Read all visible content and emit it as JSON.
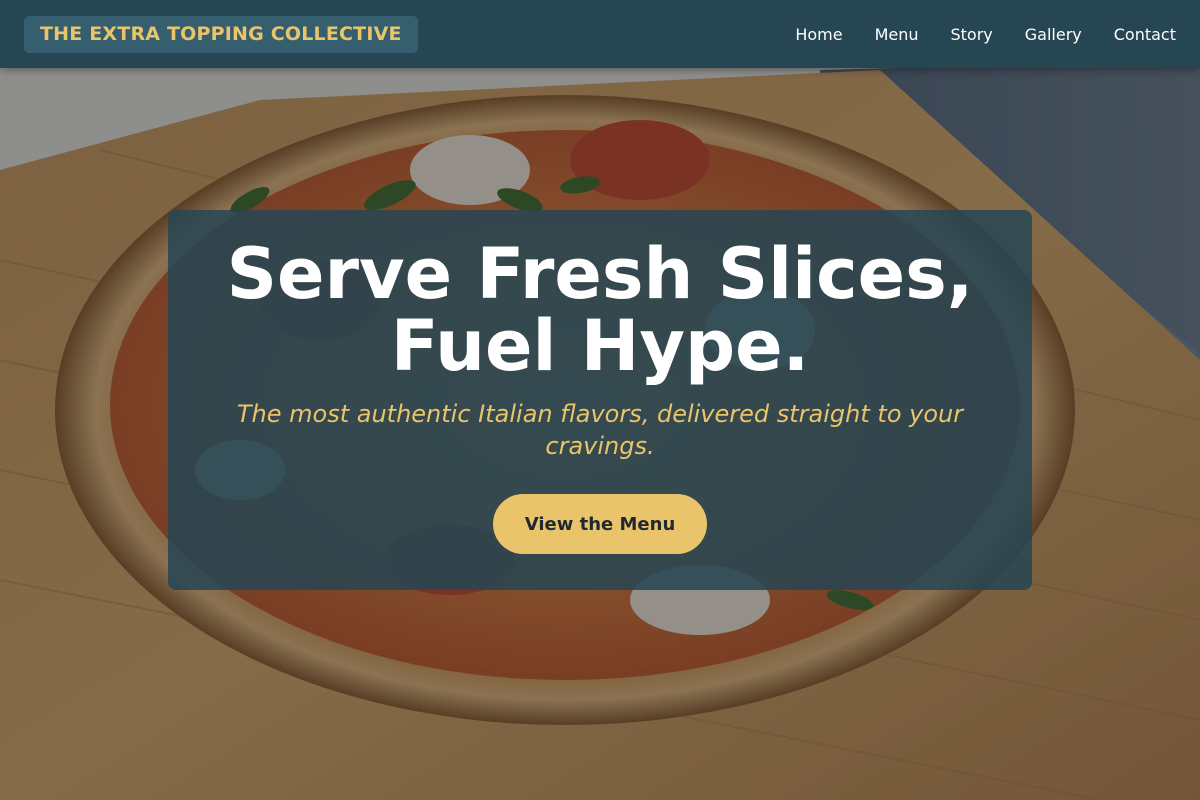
{
  "brand": {
    "name": "THE EXTRA TOPPING COLLECTIVE"
  },
  "nav": {
    "items": [
      {
        "label": "Home"
      },
      {
        "label": "Menu"
      },
      {
        "label": "Story"
      },
      {
        "label": "Gallery"
      },
      {
        "label": "Contact"
      }
    ]
  },
  "hero": {
    "title_line1": "Serve Fresh Slices,",
    "title_line2": "Fuel Hype.",
    "subtitle": "The most authentic Italian flavors, delivered straight to your cravings.",
    "cta_label": "View the Menu",
    "background": "pizza-on-wooden-board-image"
  },
  "colors": {
    "navbar": "#264653",
    "accent": "#e9c46a",
    "card": "#264653",
    "text_light": "#ffffff"
  }
}
